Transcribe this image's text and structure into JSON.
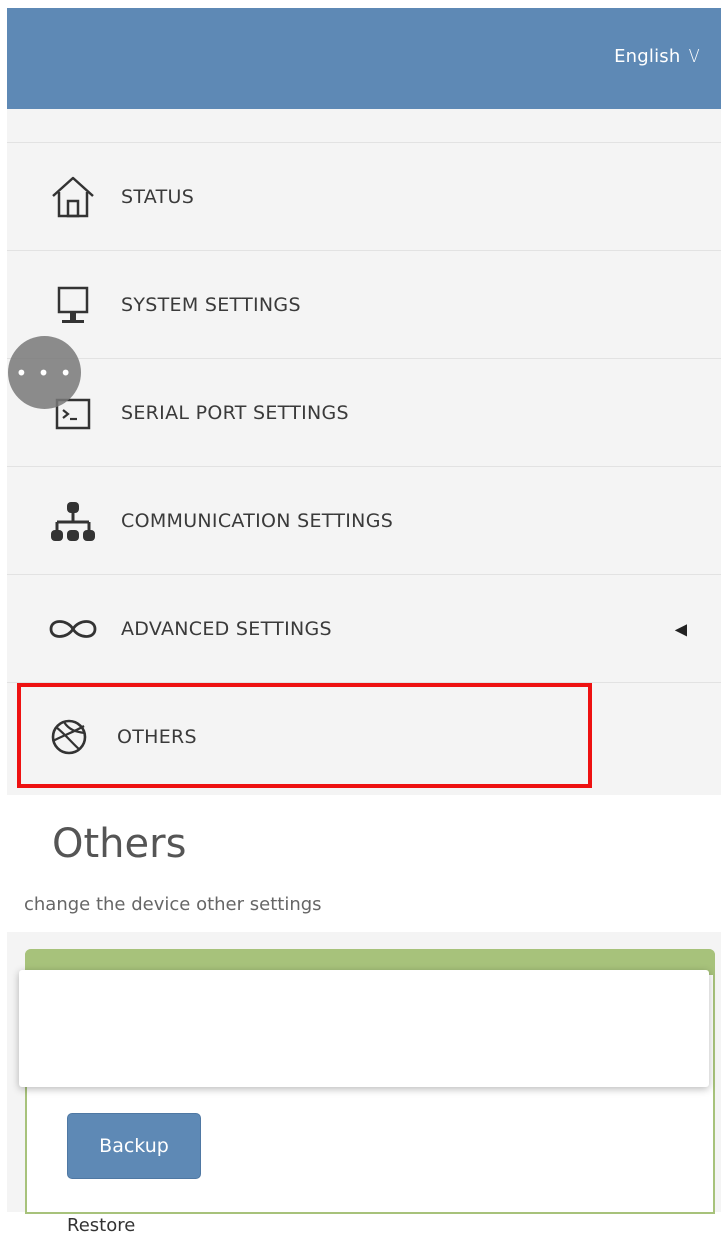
{
  "header": {
    "language": "English",
    "language_chevron": "V"
  },
  "menu": {
    "items": [
      {
        "label": "STATUS",
        "icon": "home-icon"
      },
      {
        "label": "SYSTEM SETTINGS",
        "icon": "monitor-icon"
      },
      {
        "label": "SERIAL PORT SETTINGS",
        "icon": "terminal-icon"
      },
      {
        "label": "COMMUNICATION SETTINGS",
        "icon": "network-icon"
      },
      {
        "label": "ADVANCED SETTINGS",
        "icon": "infinity-icon",
        "has_submenu": true
      },
      {
        "label": "OTHERS",
        "icon": "basketball-icon",
        "selected": true
      }
    ],
    "floating_button": "• • •"
  },
  "page": {
    "title": "Others",
    "subtitle": "change the device other settings"
  },
  "content": {
    "backup_label": "Backup",
    "restore_label": "Restore"
  },
  "colors": {
    "header_bg": "#5e89b5",
    "panel_accent": "#a7c27b",
    "highlight": "#ee1111",
    "menu_bg": "#f4f4f4"
  }
}
